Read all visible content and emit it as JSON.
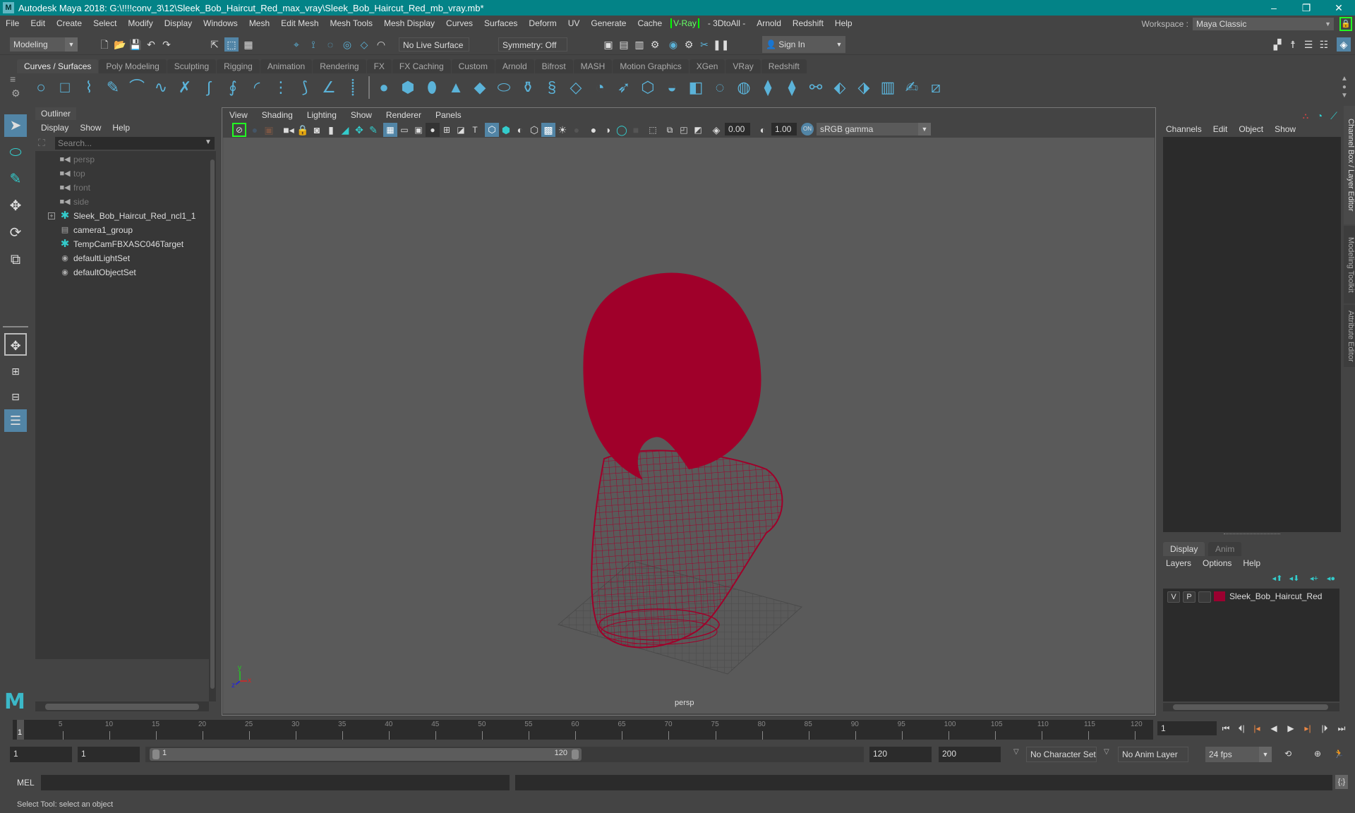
{
  "window": {
    "title": "Autodesk Maya 2018: G:\\!!!!conv_3\\12\\Sleek_Bob_Haircut_Red_max_vray\\Sleek_Bob_Haircut_Red_mb_vray.mb*",
    "minimize": "–",
    "maximize": "❐",
    "close": "✕"
  },
  "menubar": {
    "items": [
      "File",
      "Edit",
      "Create",
      "Select",
      "Modify",
      "Display",
      "Windows",
      "Mesh",
      "Edit Mesh",
      "Mesh Tools",
      "Mesh Display",
      "Curves",
      "Surfaces",
      "Deform",
      "UV",
      "Generate",
      "Cache",
      "V-Ray",
      "- 3DtoAll -",
      "Arnold",
      "Redshift",
      "Help"
    ],
    "workspace_label": "Workspace :",
    "workspace_value": "Maya Classic"
  },
  "statusline": {
    "mode": "Modeling",
    "live_surface": "No Live Surface",
    "symmetry": "Symmetry: Off",
    "sign_in": "Sign In"
  },
  "shelf": {
    "tabs": [
      "Curves / Surfaces",
      "Poly Modeling",
      "Sculpting",
      "Rigging",
      "Animation",
      "Rendering",
      "FX",
      "FX Caching",
      "Custom",
      "Arnold",
      "Bifrost",
      "MASH",
      "Motion Graphics",
      "XGen",
      "VRay",
      "Redshift"
    ],
    "active_tab": "Curves / Surfaces"
  },
  "outliner": {
    "tab": "Outliner",
    "menu": [
      "Display",
      "Show",
      "Help"
    ],
    "search_placeholder": "Search...",
    "items": [
      {
        "label": "persp",
        "icon": "camera-icon",
        "dim": true
      },
      {
        "label": "top",
        "icon": "camera-icon",
        "dim": true
      },
      {
        "label": "front",
        "icon": "camera-icon",
        "dim": true
      },
      {
        "label": "side",
        "icon": "camera-icon",
        "dim": true
      },
      {
        "label": "Sleek_Bob_Haircut_Red_ncl1_1",
        "icon": "transform-icon",
        "expandable": true
      },
      {
        "label": "camera1_group",
        "icon": "group-icon"
      },
      {
        "label": "TempCamFBXASC046Target",
        "icon": "transform-icon"
      },
      {
        "label": "defaultLightSet",
        "icon": "set-icon"
      },
      {
        "label": "defaultObjectSet",
        "icon": "set-icon"
      }
    ]
  },
  "viewport": {
    "menu": [
      "View",
      "Shading",
      "Lighting",
      "Show",
      "Renderer",
      "Panels"
    ],
    "exposure": "0.00",
    "gamma": "1.00",
    "color_space": "sRGB gamma",
    "camera_label": "persp",
    "axis": {
      "x": "x",
      "y": "y",
      "z": "z"
    },
    "wire_color": "#a0002a"
  },
  "channelbox": {
    "menu": [
      "Channels",
      "Edit",
      "Object",
      "Show"
    ]
  },
  "side_tabs": [
    "Channel Box / Layer Editor",
    "Modeling Toolkit",
    "Attribute Editor"
  ],
  "layer_editor": {
    "tabs": [
      "Display",
      "Anim"
    ],
    "menu": [
      "Layers",
      "Options",
      "Help"
    ],
    "layers": [
      {
        "v": "V",
        "p": "P",
        "name": "Sleek_Bob_Haircut_Red",
        "color": "#9b0030"
      }
    ]
  },
  "timeline": {
    "ticks": [
      5,
      10,
      15,
      20,
      25,
      30,
      35,
      40,
      45,
      50,
      55,
      60,
      65,
      70,
      75,
      80,
      85,
      90,
      95,
      100,
      105,
      110,
      115,
      120
    ],
    "current_frame": "1",
    "current_frame_field": "1",
    "range_start": "1",
    "playback_start": "1",
    "slider_start": "1",
    "slider_end": "120",
    "playback_end": "120",
    "range_end": "200",
    "character_set": "No Character Set",
    "anim_layer": "No Anim Layer",
    "fps": "24 fps"
  },
  "cmdline": {
    "label": "MEL"
  },
  "helpline": {
    "text": "Select Tool: select an object"
  }
}
